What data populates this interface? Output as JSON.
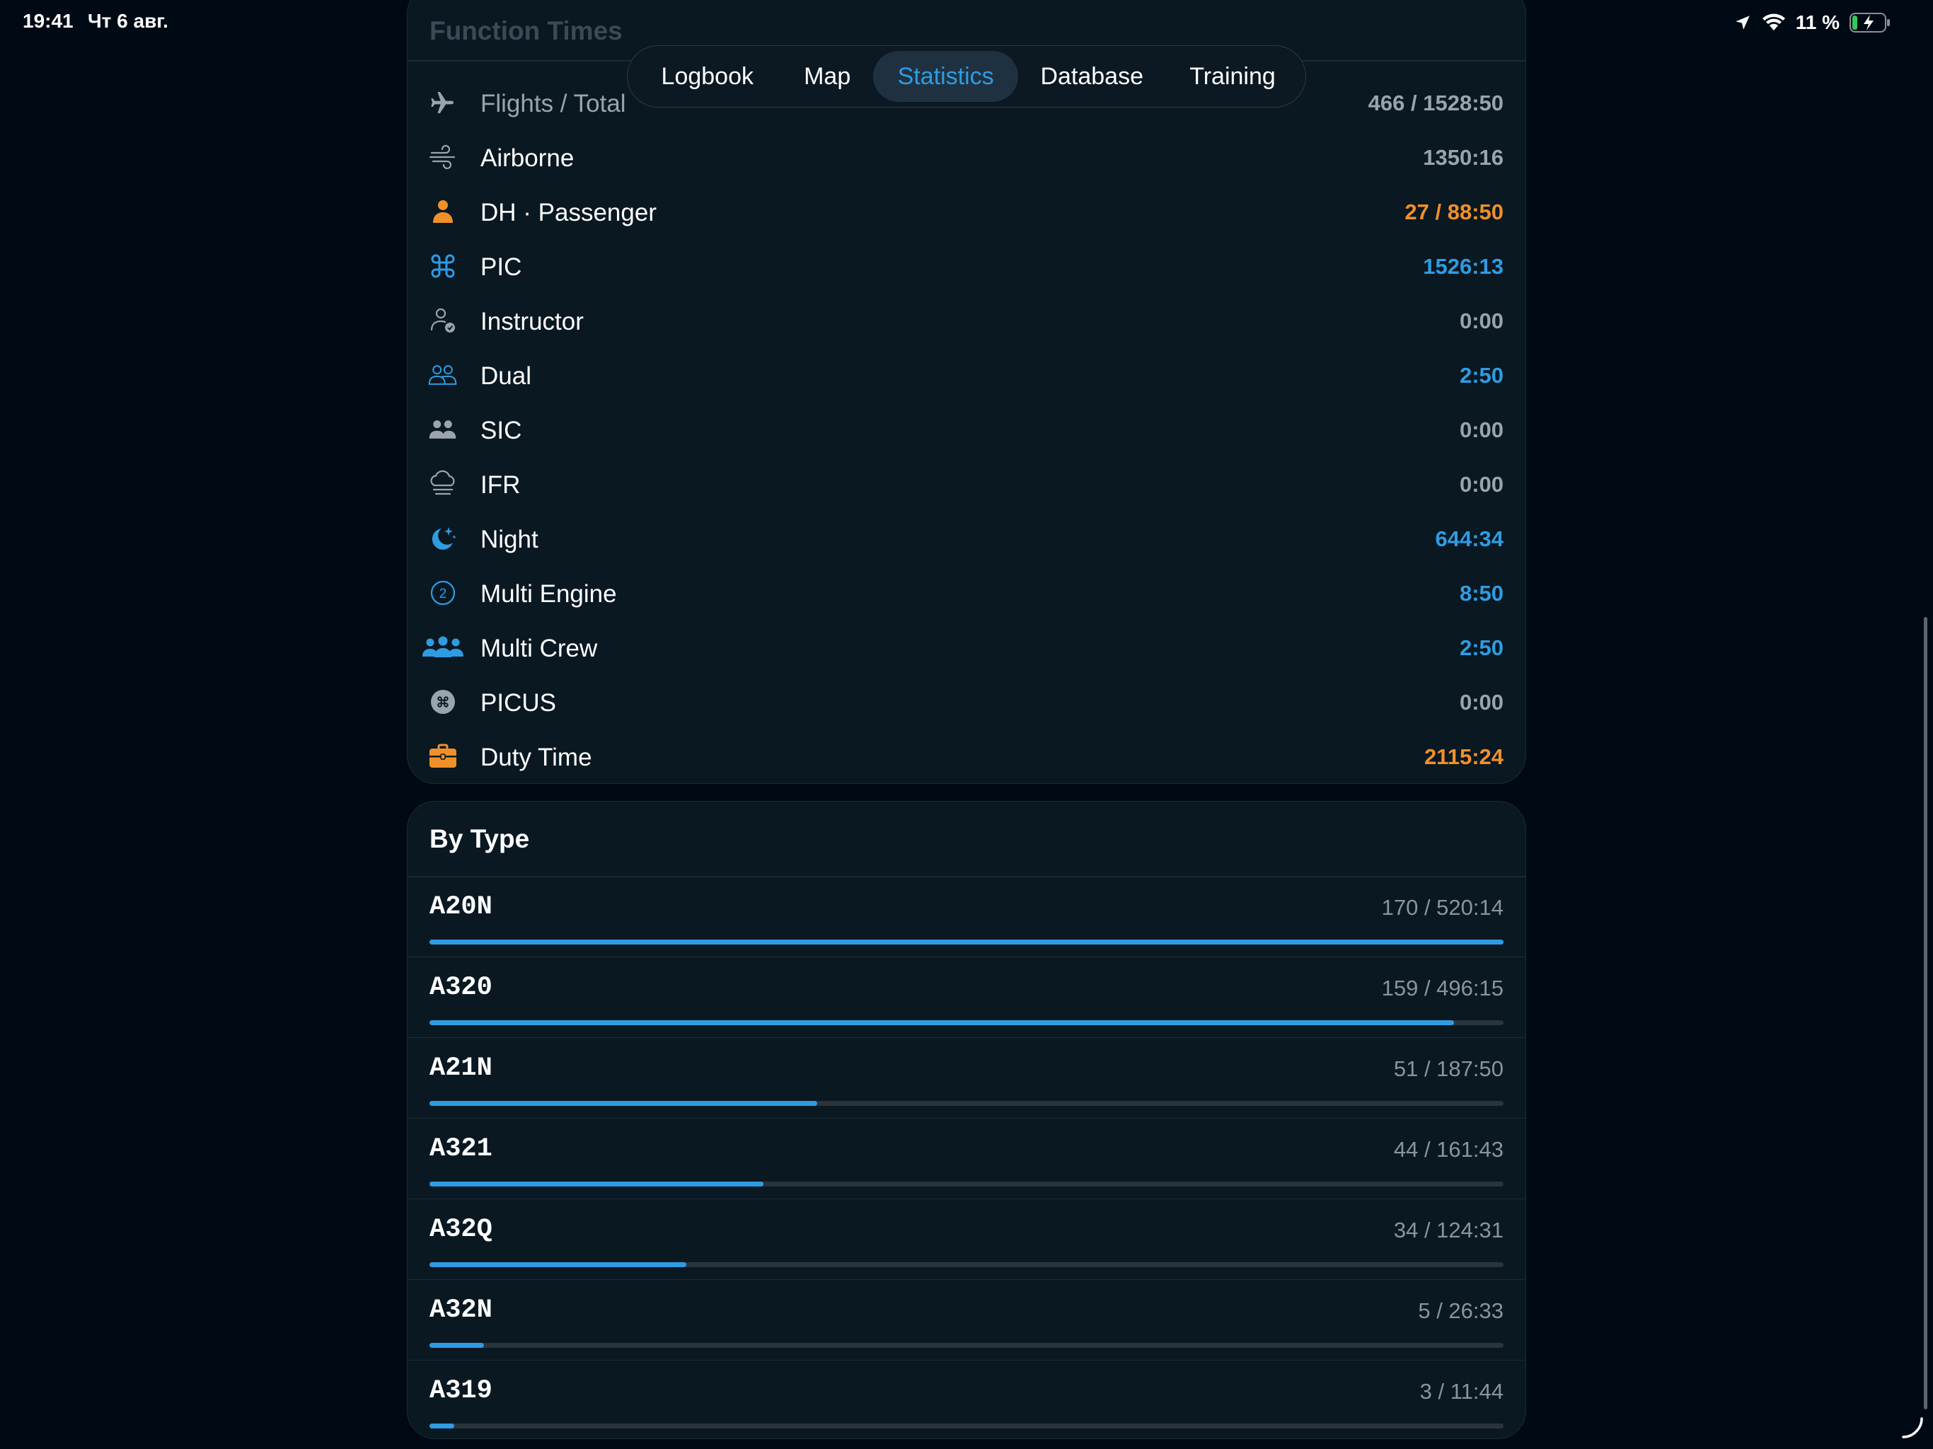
{
  "status": {
    "time": "19:41",
    "date": "Чт 6 авг.",
    "battery": "11 %"
  },
  "tabs": [
    {
      "label": "Logbook",
      "active": false
    },
    {
      "label": "Map",
      "active": false
    },
    {
      "label": "Statistics",
      "active": true
    },
    {
      "label": "Database",
      "active": false
    },
    {
      "label": "Training",
      "active": false
    }
  ],
  "function_times": {
    "title": "Function Times",
    "rows": [
      {
        "icon": "airplane-icon",
        "label": "Flights / Total",
        "value": "466 / 1528:50",
        "color": "gray"
      },
      {
        "icon": "wind-icon",
        "label": "Airborne",
        "value": "1350:16",
        "color": "gray"
      },
      {
        "icon": "person-icon",
        "label": "DH · Passenger",
        "value": "27 / 88:50",
        "color": "orange"
      },
      {
        "icon": "command-icon",
        "label": "PIC",
        "value": "1526:13",
        "color": "blue"
      },
      {
        "icon": "person-badge-icon",
        "label": "Instructor",
        "value": "0:00",
        "color": "gray"
      },
      {
        "icon": "two-persons-outline-icon",
        "label": "Dual",
        "value": "2:50",
        "color": "blue"
      },
      {
        "icon": "two-persons-icon",
        "label": "SIC",
        "value": "0:00",
        "color": "gray"
      },
      {
        "icon": "cloud-fog-icon",
        "label": "IFR",
        "value": "0:00",
        "color": "gray"
      },
      {
        "icon": "moon-stars-icon",
        "label": "Night",
        "value": "644:34",
        "color": "blue"
      },
      {
        "icon": "circle-two-icon",
        "label": "Multi Engine",
        "value": "8:50",
        "color": "blue"
      },
      {
        "icon": "three-persons-icon",
        "label": "Multi Crew",
        "value": "2:50",
        "color": "blue"
      },
      {
        "icon": "command-circle-icon",
        "label": "PICUS",
        "value": "0:00",
        "color": "gray"
      },
      {
        "icon": "briefcase-icon",
        "label": "Duty Time",
        "value": "2115:24",
        "color": "orange"
      }
    ]
  },
  "by_type": {
    "title": "By Type",
    "rows": [
      {
        "name": "A20N",
        "value": "170 / 520:14",
        "fraction": 1.0
      },
      {
        "name": "A320",
        "value": "159 / 496:15",
        "fraction": 0.954
      },
      {
        "name": "A21N",
        "value": "51 / 187:50",
        "fraction": 0.361
      },
      {
        "name": "A321",
        "value": "44 / 161:43",
        "fraction": 0.311
      },
      {
        "name": "A32Q",
        "value": "34 / 124:31",
        "fraction": 0.239
      },
      {
        "name": "A32N",
        "value": "5 / 26:33",
        "fraction": 0.051
      },
      {
        "name": "A319",
        "value": "3 / 11:44",
        "fraction": 0.023
      }
    ]
  },
  "colors": {
    "accent": "#2f9ce2",
    "orange": "#f0902a",
    "gray": "#9aa4ad",
    "background": "#000a14",
    "card": "#0a1822"
  }
}
